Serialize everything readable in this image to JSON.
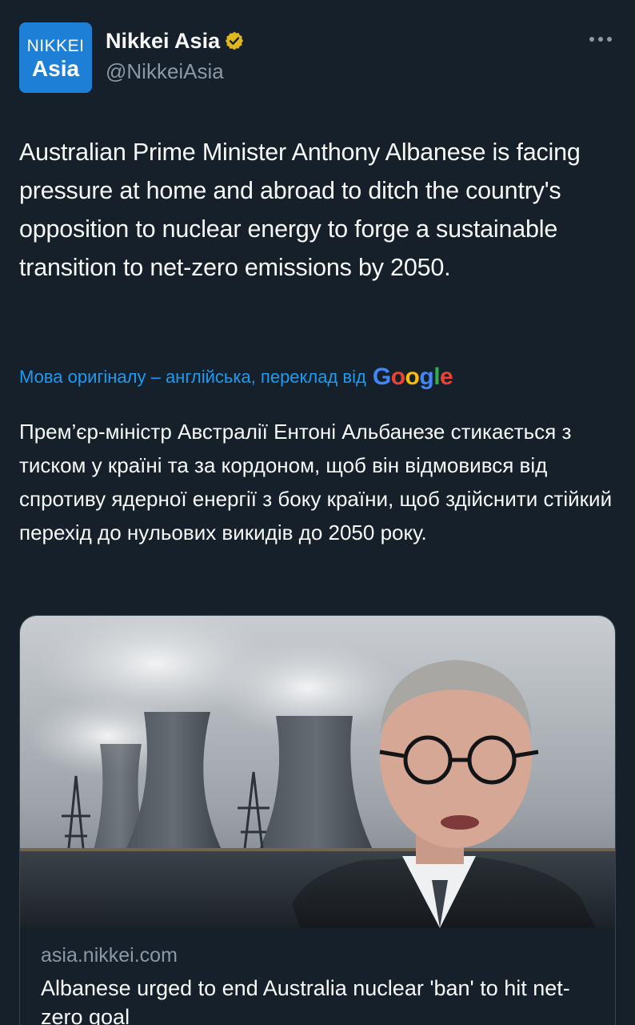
{
  "author": {
    "avatar_line1": "NIKKEI",
    "avatar_line2": "Asia",
    "display_name": "Nikkei Asia",
    "handle": "@NikkeiAsia",
    "verified_badge": "gold-verified-badge-icon",
    "more_icon": "more-horizontal-icon"
  },
  "tweet": {
    "text": "Australian Prime Minister Anthony Albanese is facing pressure at home and abroad to ditch the country's opposition to nuclear energy to forge a sustainable transition to net-zero emissions by 2050."
  },
  "translation": {
    "label": "Мова оригіналу – англійська, переклад від",
    "provider_letters": [
      "G",
      "o",
      "o",
      "g",
      "l",
      "e"
    ],
    "provider_colors": [
      "#4285f4",
      "#ea4335",
      "#fbbc05",
      "#4285f4",
      "#34a853",
      "#ea4335"
    ],
    "text": "Прем’єр-міністр Австралії Ентоні Альбанезе стикається з тиском у країні та за кордоном, щоб він відмовився від спротиву ядерної енергії з боку країни, щоб здійснити стійкий перехід до нульових викидів до 2050 року."
  },
  "card": {
    "domain": "asia.nikkei.com",
    "title": "Albanese urged to end Australia nuclear 'ban' to hit net-zero goal"
  },
  "colors": {
    "background": "#15202b",
    "text_primary": "#f7f9f9",
    "text_secondary": "#8b98a5",
    "link": "#1d9bf0",
    "avatar_blue": "#1d7fd6",
    "verified_gold": "#e2b719",
    "card_border": "#38444d"
  }
}
